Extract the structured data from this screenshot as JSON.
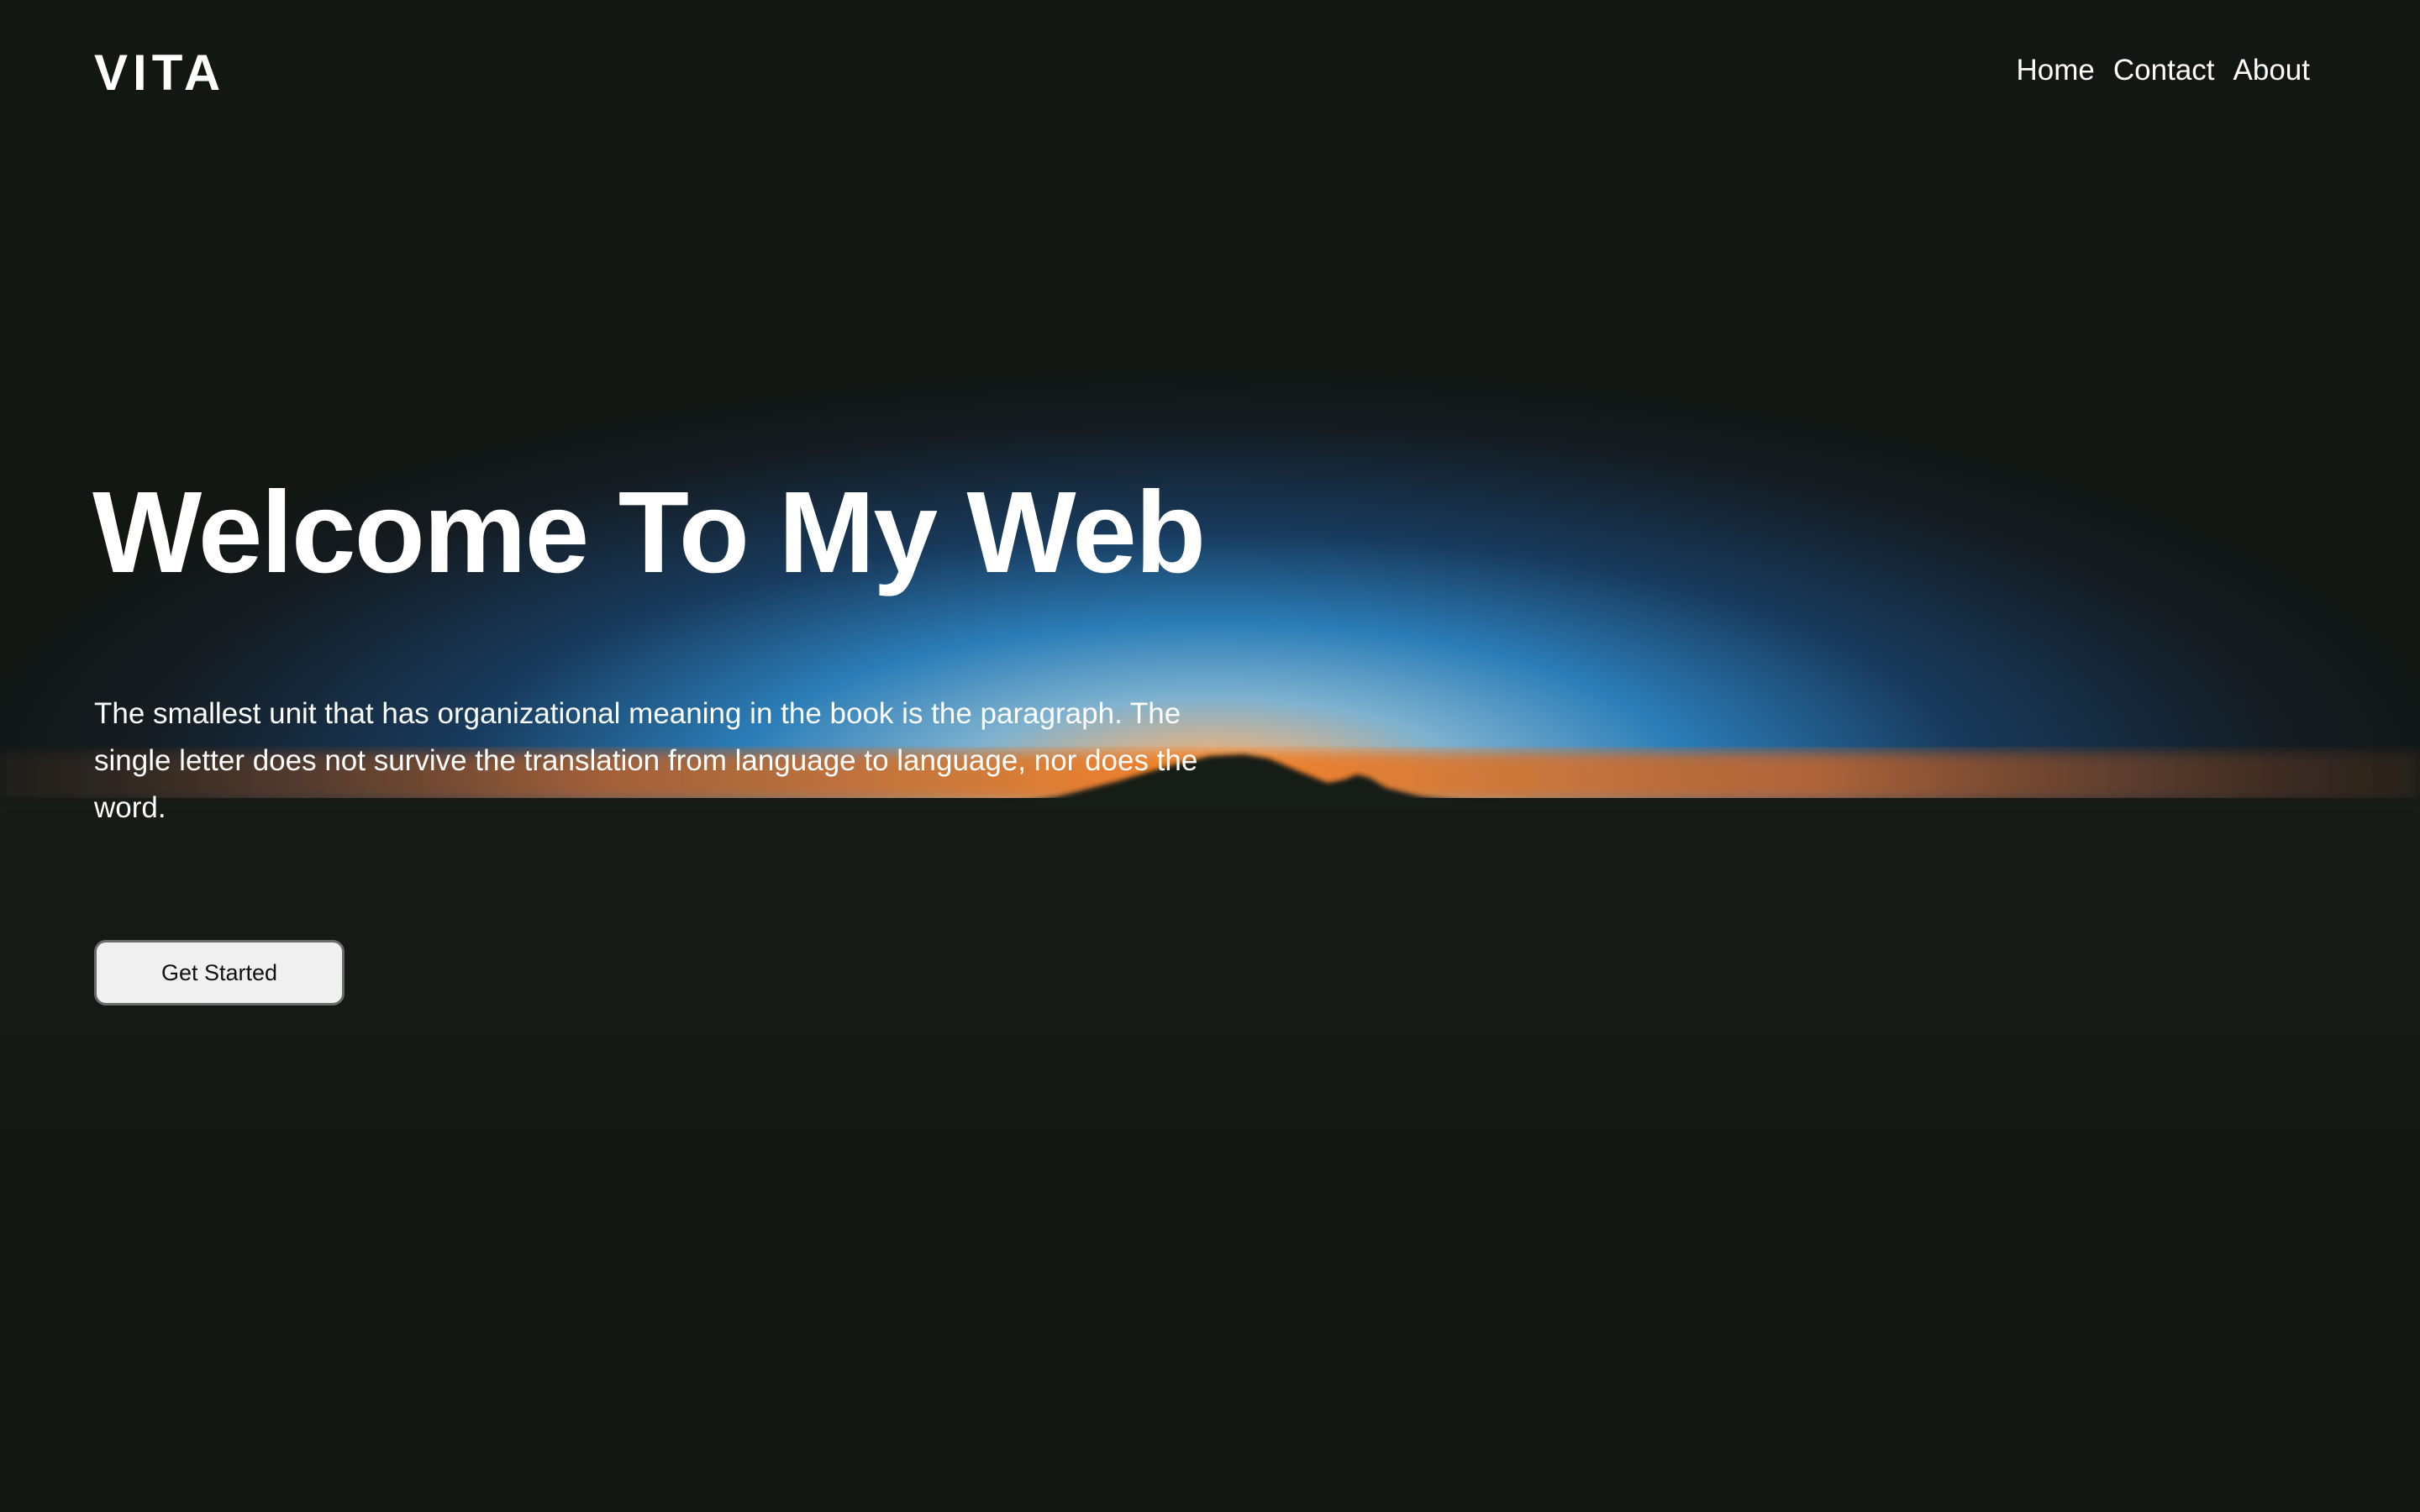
{
  "header": {
    "logo": "VITA",
    "nav": [
      {
        "label": "Home"
      },
      {
        "label": "Contact"
      },
      {
        "label": "About"
      }
    ]
  },
  "hero": {
    "headline": "Welcome To My Web",
    "paragraph": "The smallest unit that has organizational meaning in the book is the paragraph. The single letter does not survive the translation from language to language, nor does the word.",
    "cta_label": "Get Started"
  },
  "colors": {
    "background": "#121714",
    "text": "#ffffff",
    "sky_blue": "#2f7db8",
    "horizon_orange": "#f07d22",
    "button_bg": "#f0f0f0"
  }
}
